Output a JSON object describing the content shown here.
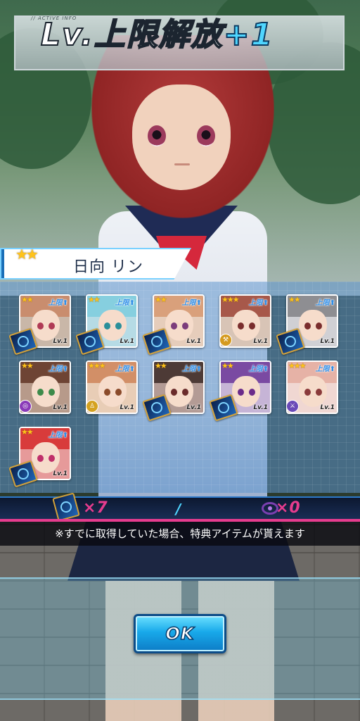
{
  "header": {
    "subtitle": "// ACTIVE INFO",
    "title_main": "Lv.上限解放",
    "title_plus": "+1"
  },
  "character": {
    "stars": "★★",
    "name": "日向 リン"
  },
  "cards": [
    {
      "stars": "★★",
      "limit_label": "上限",
      "level": "Lv.1",
      "item_icon": "book-icon",
      "hair": "#c98d6e",
      "eye": "#b03a55",
      "bg": "#c9b7a8"
    },
    {
      "stars": "★★",
      "limit_label": "上限",
      "level": "Lv.1",
      "item_icon": "book-icon",
      "hair": "#86cfdf",
      "eye": "#2a8f9a",
      "bg": "#b6dbe5"
    },
    {
      "stars": "★★",
      "limit_label": "上限",
      "level": "Lv.1",
      "item_icon": "book-icon",
      "hair": "#d9a07b",
      "eye": "#7c3d7c",
      "bg": "#e6cdbb"
    },
    {
      "stars": "★★★",
      "limit_label": "上限",
      "level": "Lv.1",
      "item_icon": "hammer-icon",
      "hair": "#a7584a",
      "eye": "#7a2d2d",
      "bg": "#d8c4b6"
    },
    {
      "stars": "★★",
      "limit_label": "上限",
      "level": "Lv.1",
      "item_icon": "book-icon",
      "hair": "#8e8e92",
      "eye": "#7a2d2d",
      "bg": "#d0d0d4"
    },
    {
      "stars": "★★",
      "limit_label": "上限",
      "level": "Lv.1",
      "item_icon": "target-icon",
      "hair": "#6e4434",
      "eye": "#3d8a4a",
      "bg": "#b79a8a"
    },
    {
      "stars": "★★★",
      "limit_label": "上限",
      "level": "Lv.1",
      "item_icon": "person-icon",
      "hair": "#d28f67",
      "eye": "#8a4a2a",
      "bg": "#e8cdb6"
    },
    {
      "stars": "★★",
      "limit_label": "上限",
      "level": "Lv.1",
      "item_icon": "book-icon",
      "hair": "#4d3a36",
      "eye": "#6a2b2b",
      "bg": "#b39b95"
    },
    {
      "stars": "★★",
      "limit_label": "上限",
      "level": "Lv.1",
      "item_icon": "book-icon",
      "hair": "#7a4aa2",
      "eye": "#6a2b8a",
      "bg": "#c6b4d6"
    },
    {
      "stars": "★★★",
      "limit_label": "上限",
      "level": "Lv.1",
      "item_icon": "sword-icon",
      "hair": "#e6b2a6",
      "eye": "#8a3a3a",
      "bg": "#f0d7d2"
    },
    {
      "stars": "★★",
      "limit_label": "上限",
      "level": "Lv.1",
      "item_icon": "book-icon",
      "hair": "#d83b3b",
      "eye": "#c0306a",
      "bg": "#e69a9a"
    }
  ],
  "counts": {
    "book_count": "×7",
    "orb_count": "×0"
  },
  "note": "※すでに取得していた場合、特典アイテムが貰えます",
  "ok_button": {
    "label": "OK"
  },
  "colors": {
    "accent": "#18a9ea",
    "pink": "#e63c8e",
    "star": "#ffc31a"
  }
}
